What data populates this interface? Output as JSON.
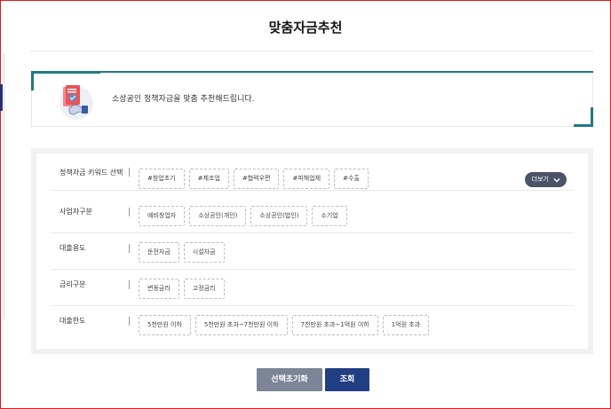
{
  "page": {
    "title": "맞춤자금추천"
  },
  "banner": {
    "text": "소상공인 정책자금을 맞춤 추천해드립니다."
  },
  "filters": {
    "keyword": {
      "label": "정책자금 키워드 선택",
      "chips": [
        "#창업초기",
        "#제조업",
        "#협력우편",
        "#피해업체",
        "#수출"
      ],
      "more_label": "더보기"
    },
    "business_type": {
      "label": "사업자구분",
      "chips": [
        "예비창업자",
        "소상공인(개인)",
        "소상공인(법인)",
        "소기업"
      ]
    },
    "loan_purpose": {
      "label": "대출용도",
      "chips": [
        "운전자금",
        "시설자금"
      ]
    },
    "interest_type": {
      "label": "금리구분",
      "chips": [
        "변동금리",
        "고정금리"
      ]
    },
    "loan_limit": {
      "label": "대출한도",
      "chips": [
        "5천만원 이하",
        "5천만원 초과~7천만원 이하",
        "7천만원 초과~1억원 이하",
        "1억원 초과"
      ]
    }
  },
  "actions": {
    "reset_label": "선택초기화",
    "search_label": "조회"
  },
  "colors": {
    "accent": "#1f7a82",
    "primary_button": "#223e82",
    "secondary_button": "#7b8597",
    "frame": "#e0191c"
  },
  "icons": {
    "banner": "handshake-document-icon",
    "more": "chevron-down-icon"
  }
}
